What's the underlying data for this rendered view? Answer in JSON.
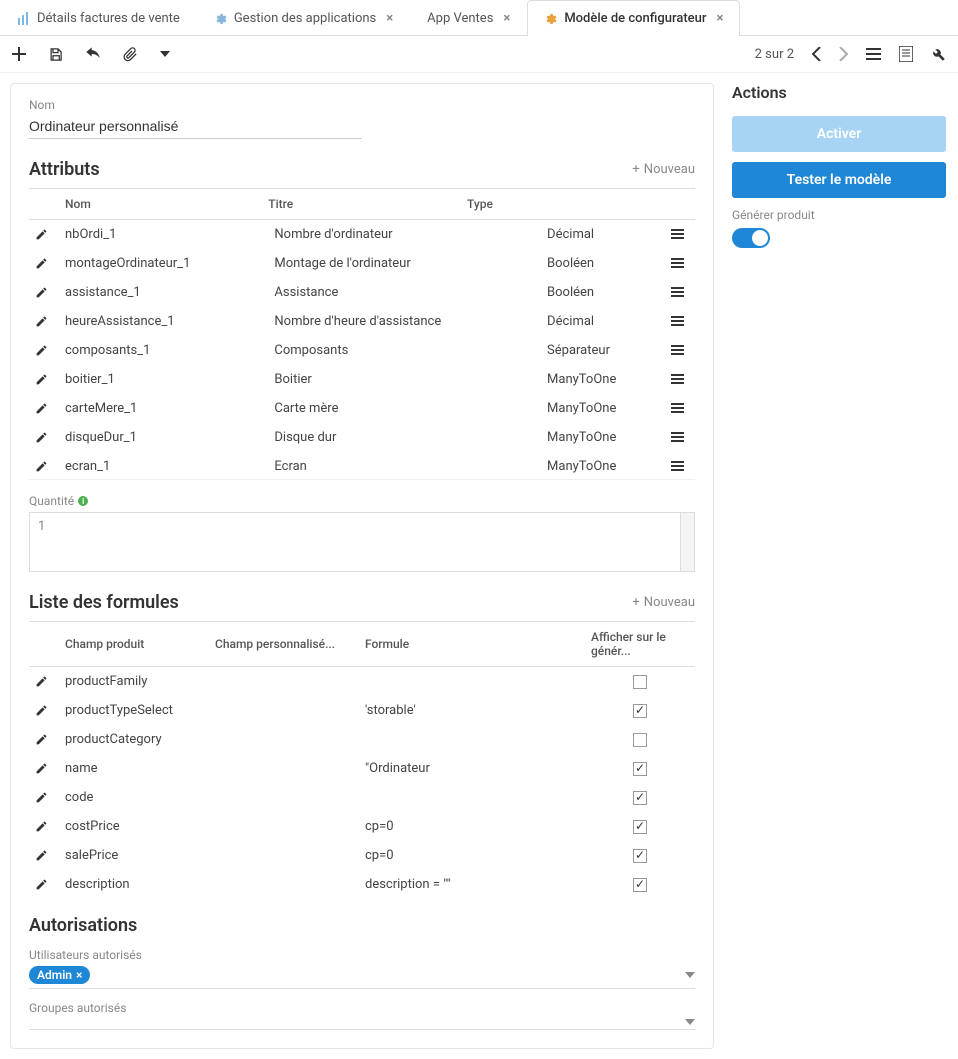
{
  "tabs": [
    {
      "label": "Détails factures de vente",
      "icon": "chart",
      "closable": false
    },
    {
      "label": "Gestion des applications",
      "icon": "gear",
      "closable": true
    },
    {
      "label": "App Ventes",
      "icon": "",
      "closable": true
    },
    {
      "label": "Modèle de configurateur",
      "icon": "gear",
      "closable": true
    }
  ],
  "activeTab": 3,
  "pager": "2 sur 2",
  "name_label": "Nom",
  "name_value": "Ordinateur personnalisé",
  "attributes": {
    "title": "Attributs",
    "new_label": "Nouveau",
    "columns": {
      "name": "Nom",
      "title": "Titre",
      "type": "Type"
    },
    "rows": [
      {
        "name": "nbOrdi_1",
        "title": "Nombre d'ordinateur",
        "type": "Décimal"
      },
      {
        "name": "montageOrdinateur_1",
        "title": "Montage de l'ordinateur",
        "type": "Booléen"
      },
      {
        "name": "assistance_1",
        "title": "Assistance",
        "type": "Booléen"
      },
      {
        "name": "heureAssistance_1",
        "title": "Nombre d'heure d'assistance",
        "type": "Décimal"
      },
      {
        "name": "composants_1",
        "title": "Composants",
        "type": "Séparateur"
      },
      {
        "name": "boitier_1",
        "title": "Boitier",
        "type": "ManyToOne"
      },
      {
        "name": "carteMere_1",
        "title": "Carte mère",
        "type": "ManyToOne"
      },
      {
        "name": "disqueDur_1",
        "title": "Disque dur",
        "type": "ManyToOne"
      },
      {
        "name": "ecran_1",
        "title": "Ecran",
        "type": "ManyToOne"
      }
    ]
  },
  "quantity": {
    "label": "Quantité",
    "value": "1"
  },
  "formulas": {
    "title": "Liste des formules",
    "new_label": "Nouveau",
    "columns": {
      "product": "Champ produit",
      "custom": "Champ personnalisé...",
      "formula": "Formule",
      "show": "Afficher sur le génér..."
    },
    "rows": [
      {
        "product": "productFamily",
        "custom": "",
        "formula": "",
        "show": false
      },
      {
        "product": "productTypeSelect",
        "custom": "",
        "formula": "'storable'",
        "show": true
      },
      {
        "product": "productCategory",
        "custom": "",
        "formula": "",
        "show": false
      },
      {
        "product": "name",
        "custom": "",
        "formula": "\"Ordinateur",
        "show": true
      },
      {
        "product": "code",
        "custom": "",
        "formula": "",
        "show": true
      },
      {
        "product": "costPrice",
        "custom": "",
        "formula": "cp=0",
        "show": true
      },
      {
        "product": "salePrice",
        "custom": "",
        "formula": "cp=0",
        "show": true
      },
      {
        "product": "description",
        "custom": "",
        "formula": "description = \"\"",
        "show": true
      }
    ]
  },
  "authorizations": {
    "title": "Autorisations",
    "users_label": "Utilisateurs autorisés",
    "user_chip": "Admin",
    "groups_label": "Groupes autorisés"
  },
  "sidebar": {
    "title": "Actions",
    "activate": "Activer",
    "test": "Tester le modèle",
    "generate_label": "Générer produit",
    "generate_on": true
  }
}
